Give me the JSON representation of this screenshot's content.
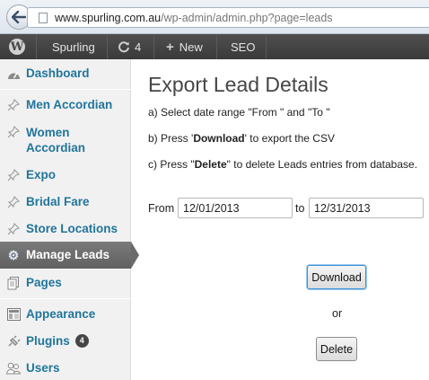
{
  "browser": {
    "url_domain": "www.spurling.com.au",
    "url_path": "/wp-admin/admin.php?page=leads"
  },
  "adminbar": {
    "site_name": "Spurling",
    "updates_count": "4",
    "new_label": "New",
    "seo_label": "SEO"
  },
  "sidebar": {
    "items": [
      {
        "label": "Dashboard",
        "icon": "dashboard-icon"
      },
      {
        "label": "Men Accordian",
        "icon": "pushpin-icon"
      },
      {
        "label": "Women Accordian",
        "icon": "pushpin-icon"
      },
      {
        "label": "Expo",
        "icon": "pushpin-icon"
      },
      {
        "label": "Bridal Fare",
        "icon": "pushpin-icon"
      },
      {
        "label": "Store Locations",
        "icon": "pushpin-icon"
      },
      {
        "label": "Manage Leads",
        "icon": "gear-icon"
      },
      {
        "label": "Pages",
        "icon": "pages-icon"
      },
      {
        "label": "Appearance",
        "icon": "appearance-icon"
      },
      {
        "label": "Plugins",
        "icon": "plugin-icon",
        "badge": "4"
      },
      {
        "label": "Users",
        "icon": "users-icon"
      }
    ]
  },
  "main": {
    "title": "Export Lead Details",
    "step_a": "a) Select date range \"From \" and \"To \"",
    "step_b_pre": "b) Press '",
    "step_b_bold": "Download",
    "step_b_post": "' to export the CSV",
    "step_c_pre": "c) Press \"",
    "step_c_bold": "Delete",
    "step_c_post": "\" to delete Leads entries from database.",
    "from_label": "From",
    "from_value": "12/01/2013",
    "to_label": "to",
    "to_value": "12/31/2013",
    "download_label": "Download",
    "or_label": "or",
    "delete_label": "Delete"
  },
  "colors": {
    "link": "#21759b",
    "adminbar": "#464646",
    "current_menu": "#6b6b6b"
  }
}
